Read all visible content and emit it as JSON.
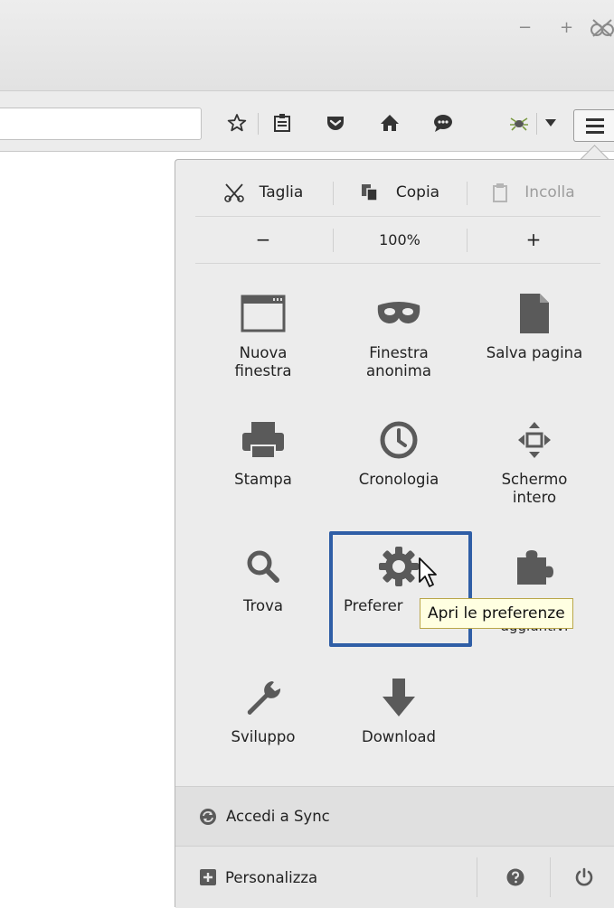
{
  "window": {
    "minimize_label": "−",
    "maximize_label": "+"
  },
  "panel": {
    "edit": {
      "cut": "Taglia",
      "copy": "Copia",
      "paste": "Incolla"
    },
    "zoom": {
      "minus": "−",
      "level": "100%",
      "plus": "+"
    },
    "items": [
      {
        "label": "Nuova finestra"
      },
      {
        "label": "Finestra anonima"
      },
      {
        "label": "Salva pagina"
      },
      {
        "label": "Stampa"
      },
      {
        "label": "Cronologia"
      },
      {
        "label": "Schermo intero"
      },
      {
        "label": "Trova"
      },
      {
        "label": "Preferer"
      },
      {
        "label": "aggiuntivi"
      },
      {
        "label": "Sviluppo"
      },
      {
        "label": "Download"
      }
    ],
    "sync_label": "Accedi a Sync",
    "customize_label": "Personalizza",
    "tooltip": "Apri le preferenze"
  },
  "colors": {
    "highlight": "#2f5ea6",
    "tooltip_bg": "#ffffe1"
  }
}
